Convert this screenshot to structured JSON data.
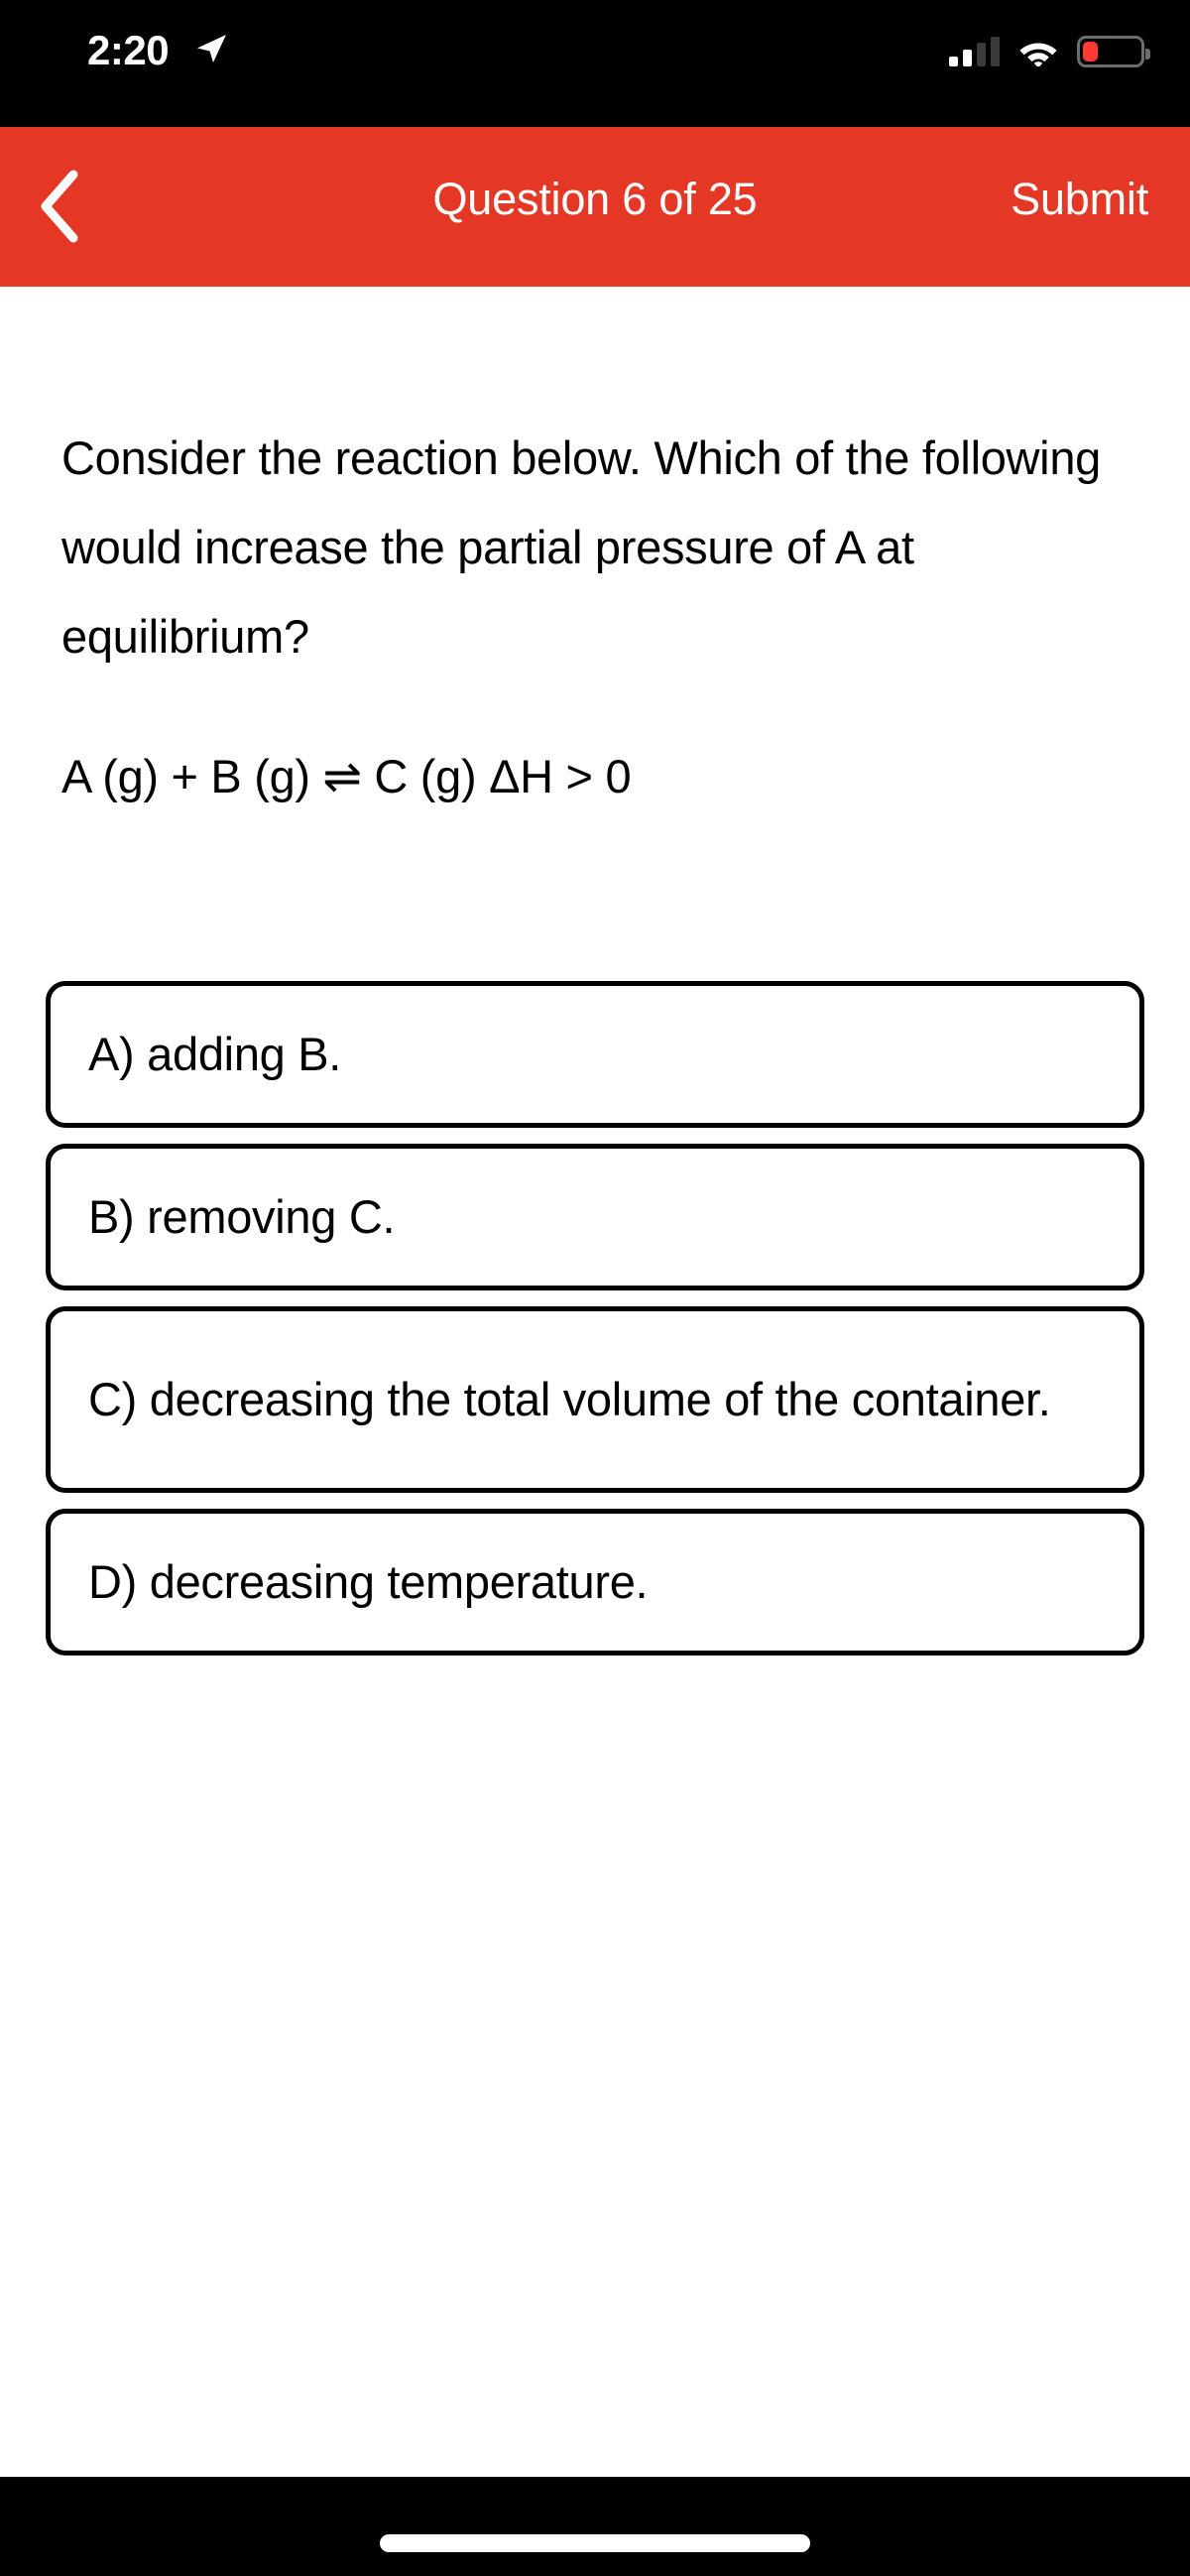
{
  "status_bar": {
    "time": "2:20",
    "location_icon": "location-arrow-icon",
    "signal_icon": "cellular-signal-icon",
    "signal_bars_filled": 2,
    "signal_bars_total": 4,
    "wifi_icon": "wifi-icon",
    "battery_icon": "battery-low-icon",
    "battery_level_percent": 20,
    "battery_color": "#ff3b30",
    "background_color": "#000000"
  },
  "nav_bar": {
    "back_icon": "chevron-left-icon",
    "title": "Question 6 of 25",
    "submit_label": "Submit",
    "background_color": "#e43725",
    "text_color": "#ffffff"
  },
  "question": {
    "stem": "Consider the reaction below. Which of the following would increase the partial pressure of A at equilibrium?",
    "equation": "A (g) + B (g) ⇌ C (g) ΔH > 0",
    "number": 6,
    "total": 25
  },
  "options": [
    {
      "id": "A",
      "text": "A) adding B.",
      "lines": 1,
      "selected": false
    },
    {
      "id": "B",
      "text": "B) removing C.",
      "lines": 1,
      "selected": false
    },
    {
      "id": "C",
      "text": "C) decreasing the total volume of the container.",
      "lines": 2,
      "selected": false
    },
    {
      "id": "D",
      "text": "D) decreasing temperature.",
      "lines": 1,
      "selected": false
    }
  ],
  "home_bar": {
    "indicator": "home-indicator",
    "background_color": "#000000"
  }
}
